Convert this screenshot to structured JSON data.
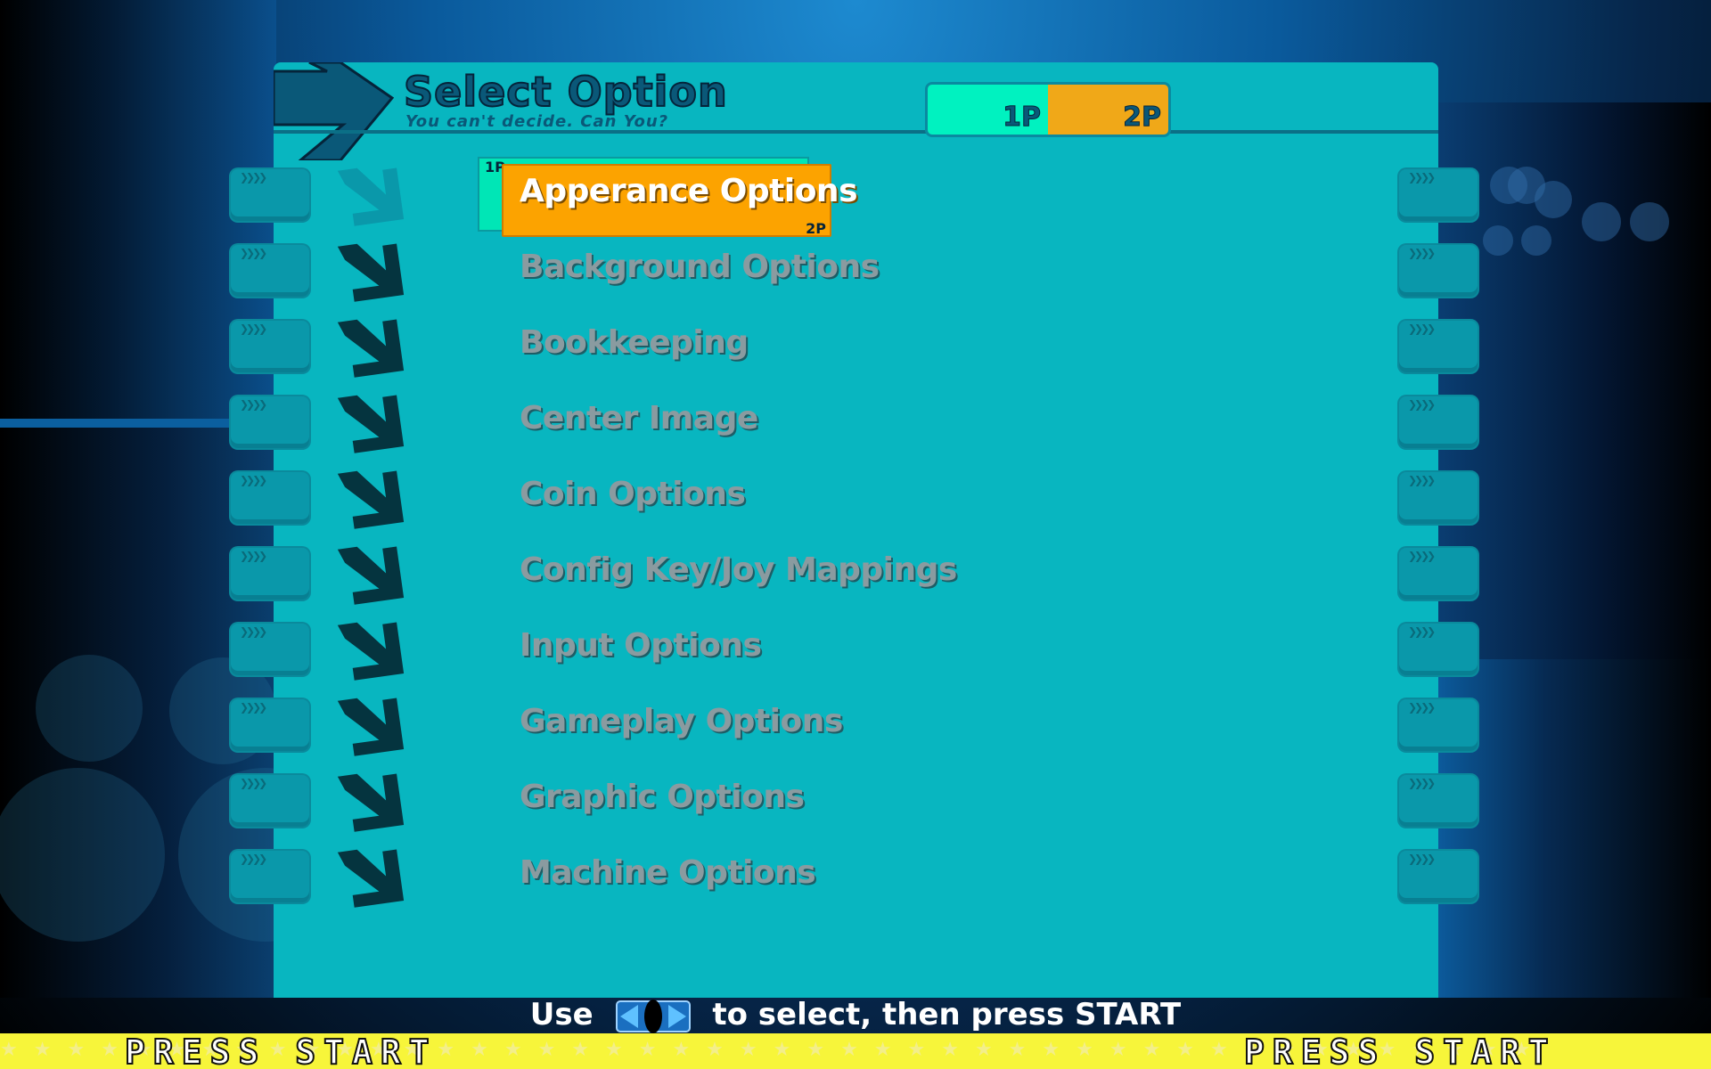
{
  "header": {
    "title": "Select Option",
    "subtitle": "You can't decide. Can You?"
  },
  "players": {
    "p1_label": "1P",
    "p2_label": "2P"
  },
  "selection": {
    "p1_marker": "1P",
    "p2_marker": "2P",
    "selected_index": 0
  },
  "menu": {
    "items": [
      {
        "label": "Apperance Options"
      },
      {
        "label": "Background Options"
      },
      {
        "label": "Bookkeeping"
      },
      {
        "label": "Center Image"
      },
      {
        "label": "Coin Options"
      },
      {
        "label": "Config Key/Joy Mappings"
      },
      {
        "label": "Input Options"
      },
      {
        "label": "Gameplay Options"
      },
      {
        "label": "Graphic Options"
      },
      {
        "label": "Machine Options"
      }
    ]
  },
  "footer": {
    "hint_prefix": "Use",
    "hint_suffix": "to select, then press START",
    "hint_icon": "left-right-arrows-icon",
    "press_start_left": "PRESS START",
    "press_start_right": "PRESS START"
  },
  "colors": {
    "panel": "#08b6c0",
    "selected_2p": "#fca300",
    "selected_1p": "#00e6b6",
    "menu_text": "#8a9ba0",
    "footer_bar": "#f7f53a"
  }
}
